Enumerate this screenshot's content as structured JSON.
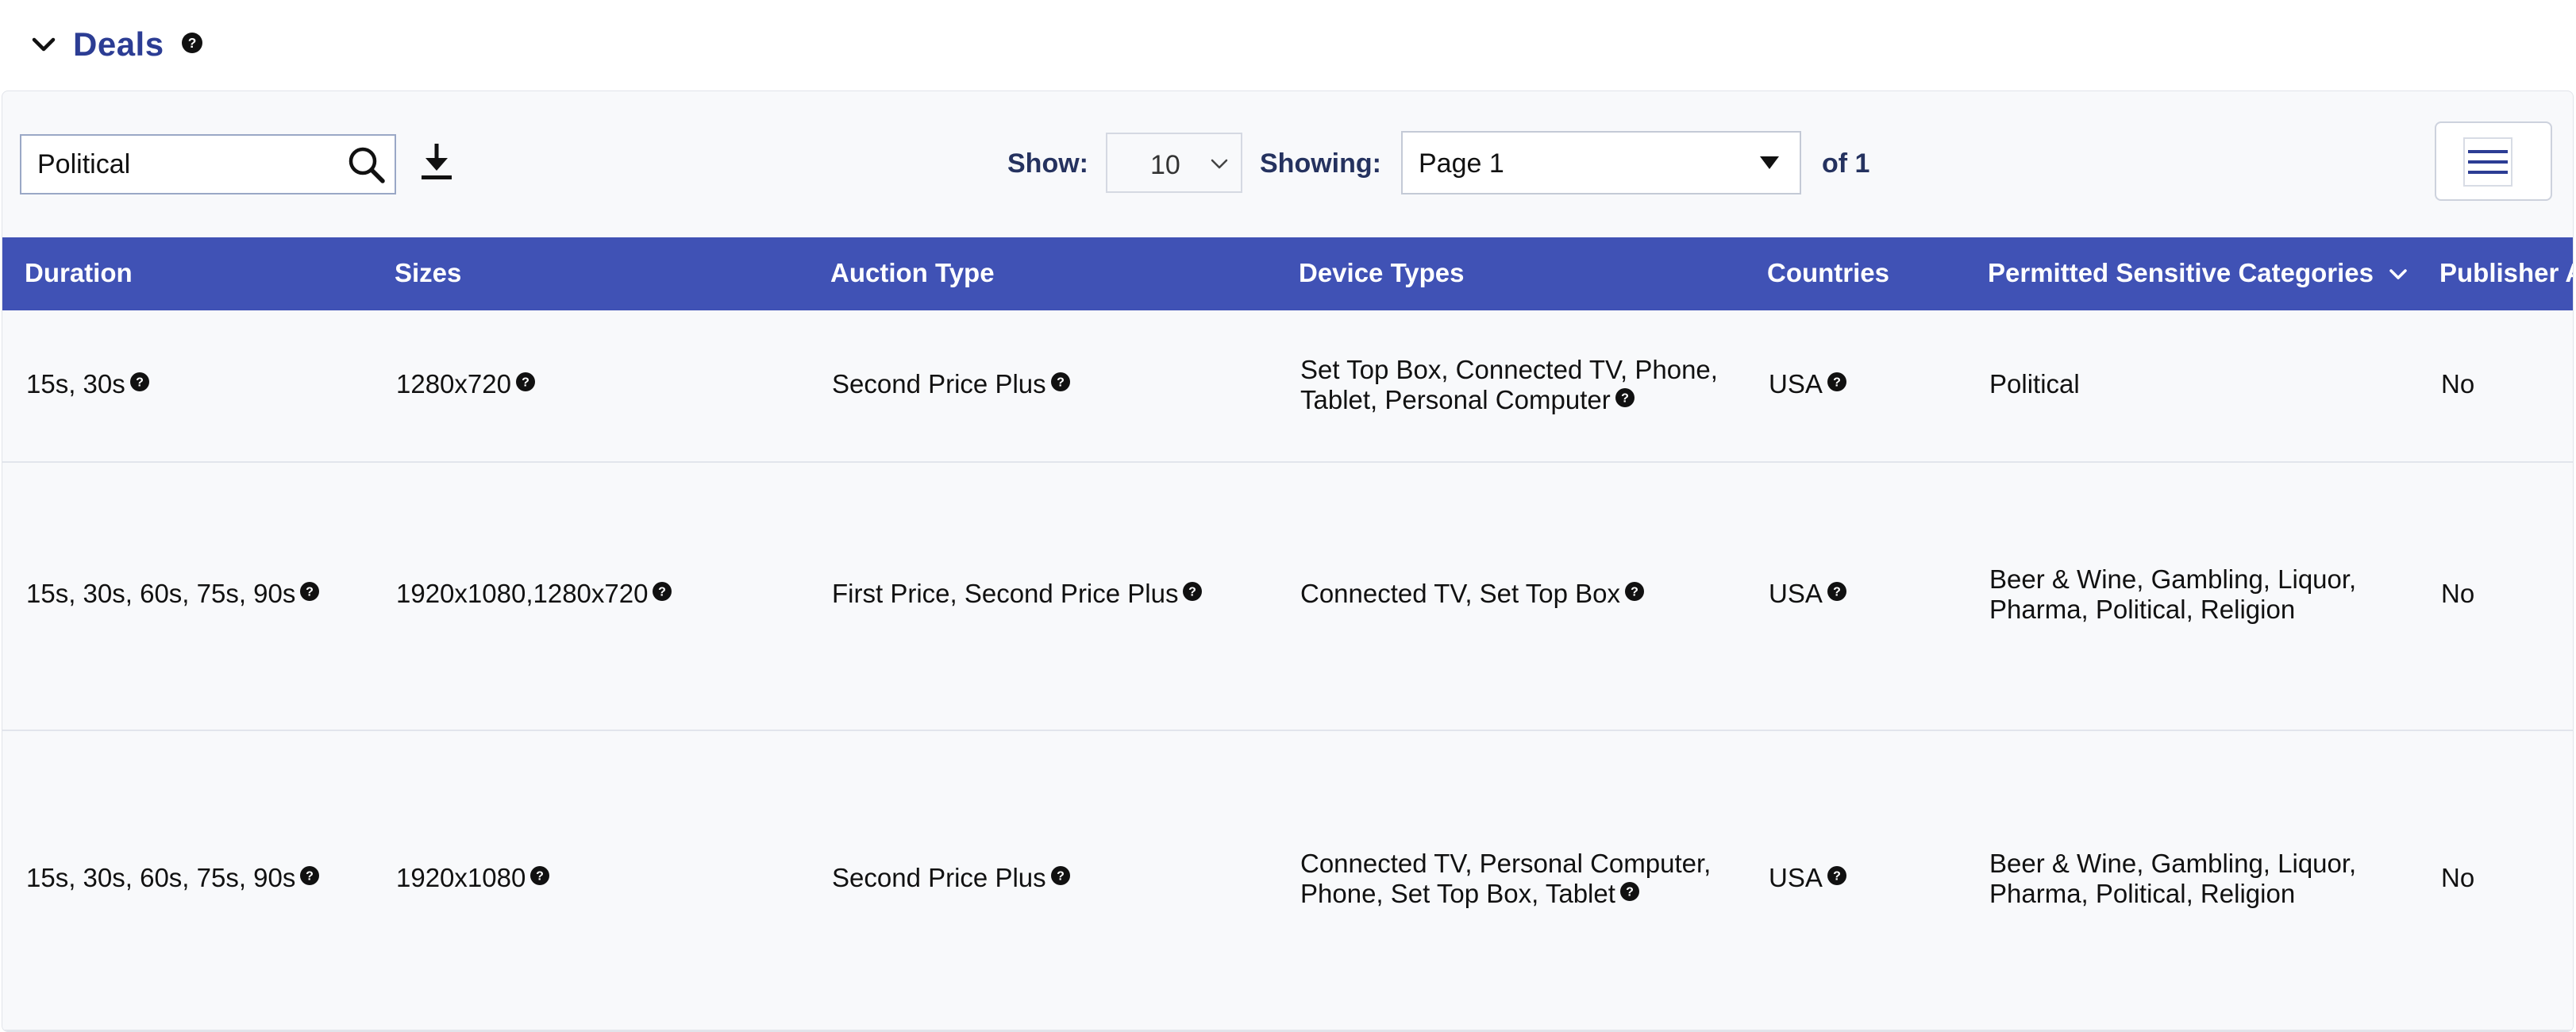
{
  "section": {
    "title": "Deals"
  },
  "toolbar": {
    "search_value": "Political",
    "show_label": "Show:",
    "show_value": "10",
    "showing_label": "Showing:",
    "page_value": "Page 1",
    "of_label": "of 1"
  },
  "table": {
    "headers": [
      "Duration",
      "Sizes",
      "Auction Type",
      "Device Types",
      "Countries",
      "Permitted Sensitive Categories",
      "Publisher A"
    ],
    "rows": [
      {
        "duration": "15s, 30s",
        "sizes": "1280x720",
        "auction_type": "Second Price Plus",
        "device_types_1": "Set Top Box, Connected TV, Phone,",
        "device_types_2": "Tablet, Personal Computer",
        "countries": "USA",
        "categories_1": "Political",
        "categories_2": "",
        "publisher": "No"
      },
      {
        "duration": "15s, 30s, 60s, 75s, 90s",
        "sizes": "1920x1080,1280x720",
        "auction_type": "First Price, Second Price Plus",
        "device_types_1": "Connected TV, Set Top Box",
        "device_types_2": "",
        "countries": "USA",
        "categories_1": "Beer & Wine, Gambling, Liquor,",
        "categories_2": "Pharma, Political, Religion",
        "publisher": "No"
      },
      {
        "duration": "15s, 30s, 60s, 75s, 90s",
        "sizes": "1920x1080",
        "auction_type": "Second Price Plus",
        "device_types_1": "Connected TV, Personal Computer,",
        "device_types_2": "Phone, Set Top Box, Tablet",
        "countries": "USA",
        "categories_1": "Beer & Wine, Gambling, Liquor,",
        "categories_2": "Pharma, Political, Religion",
        "publisher": "No"
      }
    ]
  },
  "icons": {
    "collapse": "chevron-down-icon",
    "help": "question-circle-icon",
    "search": "search-icon",
    "download": "download-icon",
    "menu": "hamburger-menu-icon",
    "sort": "chevron-down-icon"
  },
  "colors": {
    "title": "#2c3d94",
    "header_bg": "#4052b5",
    "header_text": "#ffffff",
    "label_text": "#25325f",
    "panel_bg": "#f8f9fb"
  }
}
